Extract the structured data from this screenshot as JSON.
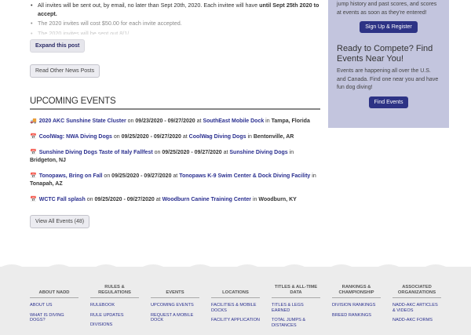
{
  "announcement": {
    "items": [
      {
        "text": "All invites will be sent out, by email, no later than Sept 20th, 2020. Each invitee will have ",
        "bold": "until Sept 25th 2020 to accept."
      },
      {
        "text": "The 2020 invites will cost $50.00 for each invite accepted."
      },
      {
        "text": "The 2020 invites will be sent out 8/1/..."
      }
    ],
    "expand_label": "Expand this post",
    "read_other_label": "Read Other News Posts"
  },
  "events": {
    "heading": "UPCOMING EVENTS",
    "items": [
      {
        "icon": "truck-icon",
        "name": "2020 AKC Sunshine State Cluster",
        "on": " on ",
        "dates": "09/23/2020 - 09/27/2020",
        "at": " at ",
        "venue": "SouthEast Mobile Dock",
        "in": " in ",
        "location": "Tampa, Florida"
      },
      {
        "icon": "calendar-icon",
        "name": "CoolWag: NWA Diving Dogs",
        "on": " on ",
        "dates": "09/25/2020 - 09/27/2020",
        "at": " at ",
        "venue": "CoolWag Diving Dogs",
        "in": " in ",
        "location": "Bentonville, AR"
      },
      {
        "icon": "calendar-icon",
        "name": "Sunshine Diving Dogs Taste of Italy Fallfest",
        "on": " on ",
        "dates": "09/25/2020 - 09/27/2020",
        "at": " at ",
        "venue": "Sunshine Diving Dogs",
        "in": " in ",
        "location": "Bridgeton, NJ"
      },
      {
        "icon": "calendar-icon",
        "name": "Tonopaws, Bring on Fall",
        "on": " on ",
        "dates": "09/25/2020 - 09/27/2020",
        "at": " at ",
        "venue": "Tonopaws K-9 Swim Center & Dock Diving Facility",
        "in": " in ",
        "location": "Tonapah, AZ"
      },
      {
        "icon": "calendar-icon",
        "name": "WCTC Fall splash",
        "on": " on ",
        "dates": "09/25/2020 - 09/27/2020",
        "at": " at ",
        "venue": "Woodburn Canine Training Center",
        "in": " in ",
        "location": "Woodburn, KY"
      }
    ],
    "view_all_label": "View All Events (48)"
  },
  "sidebar": {
    "intro": "jump history and past scores, and scores at events as soon as they're entered!",
    "signup_label": "Sign Up & Register",
    "compete_heading": "Ready to Compete? Find Events Near You!",
    "compete_text": "Events are happening all over the U.S. and Canada. Find one near you and have fun dog diving!",
    "find_label": "Find Events"
  },
  "footer": {
    "columns": [
      {
        "heading": "ABOUT NADD",
        "links": [
          "ABOUT US",
          "WHAT IS DIVING DOGS?"
        ]
      },
      {
        "heading": "RULES & REGULATIONS",
        "links": [
          "RULEBOOK",
          "RULE UPDATES",
          "DIVISIONS"
        ]
      },
      {
        "heading": "EVENTS",
        "links": [
          "UPCOMING EVENTS",
          "REQUEST A MOBILE DOCK"
        ]
      },
      {
        "heading": "LOCATIONS",
        "links": [
          "FACILITIES & MOBILE DOCKS",
          "FACILITY APPLICATION"
        ]
      },
      {
        "heading": "TITLES & ALL-TIME DATA",
        "links": [
          "TITLES & LEGS EARNED",
          "TOTAL JUMPS & DISTANCES"
        ]
      },
      {
        "heading": "RANKINGS & CHAMPIONSHIP",
        "links": [
          "DIVISION RANKINGS",
          "BREED RANKINGS"
        ]
      },
      {
        "heading": "ASSOCIATED ORGANIZATIONS",
        "links": [
          "NADD-AKC ARTICLES & VIDEOS",
          "NADD-AKC FORMS"
        ]
      }
    ]
  },
  "colors": {
    "link": "#2a2f8f",
    "sidebar_bg": "#c3c5de",
    "button_dark": "#2d3385",
    "footer_bg": "#ececec"
  }
}
